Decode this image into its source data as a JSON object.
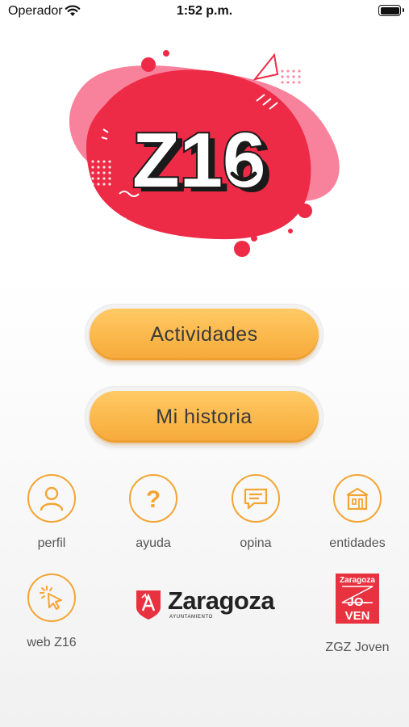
{
  "status_bar": {
    "carrier": "Operador",
    "time": "1:52 p.m."
  },
  "logo": {
    "text": "Z16",
    "colors": {
      "red": "#ee2b46",
      "pink": "#f8819b",
      "black": "#1a1a1a"
    }
  },
  "buttons": {
    "actividades": "Actividades",
    "mi_historia": "Mi historia"
  },
  "menu": [
    {
      "label": "perfil",
      "icon": "user-icon"
    },
    {
      "label": "ayuda",
      "icon": "question-icon"
    },
    {
      "label": "opina",
      "icon": "speech-bubble-icon"
    },
    {
      "label": "entidades",
      "icon": "building-icon"
    },
    {
      "label": "web Z16",
      "icon": "cursor-click-icon"
    }
  ],
  "partners": {
    "zaragoza_name": "Zaragoza",
    "zaragoza_sub": "AYUNTAMIENTO",
    "zgz_joven_badge_top": "Zaragoza",
    "zgz_joven_badge_line1": "JO-",
    "zgz_joven_badge_line2": "VEN",
    "zgz_joven_label": "ZGZ Joven"
  },
  "colors": {
    "accent_orange": "#f3a533",
    "button_orange": "#fbb84b",
    "brand_red": "#e8323f"
  }
}
